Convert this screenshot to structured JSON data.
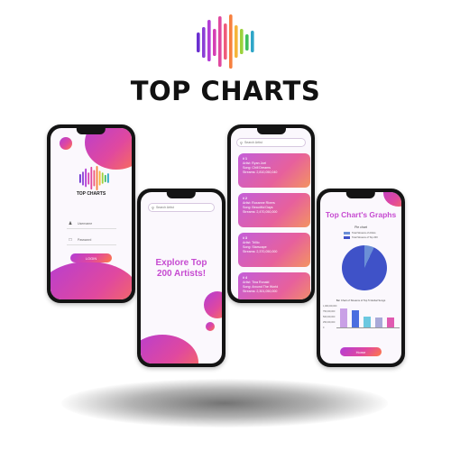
{
  "brand": {
    "title": "TOP CHARTS",
    "bar_colors": [
      "#6a2fd0",
      "#8b3fd6",
      "#b23dd6",
      "#d63fb4",
      "#e0489f",
      "#ef5b7a",
      "#f7803e",
      "#f5b53a",
      "#9bd23c",
      "#3fbf5c",
      "#2fa6c8"
    ]
  },
  "login": {
    "logo_title": "TOP CHARTS",
    "username_placeholder": "Username",
    "password_placeholder": "Password",
    "login_button": "LOGIN"
  },
  "explore": {
    "search_placeholder": "Search Artist",
    "headline_line1": "Explore Top",
    "headline_line2": "200 Artists!"
  },
  "list": {
    "search_placeholder": "Search Artist",
    "cards": [
      {
        "rank": "# 1",
        "artist": "Artist: Ryan Joel",
        "song": "Song: Chill Dreams",
        "streams": "Streams: 2,810,050,040"
      },
      {
        "rank": "# 2",
        "artist": "Artist: Roxanne Rivers",
        "song": "Song: Beautiful Days",
        "streams": "Streams: 2,470,050,000"
      },
      {
        "rank": "# 3",
        "artist": "Artist: Trillio",
        "song": "Song: Starscape",
        "streams": "Streams: 2,370,050,000"
      },
      {
        "rank": "# 4",
        "artist": "Artist: Tina Ronald",
        "song": "Song: Around The World",
        "streams": "Streams: 2,301,050,000"
      }
    ]
  },
  "graphs": {
    "title": "Top Chart's Graphs",
    "pie_caption": "Pie chart",
    "pie_legend": [
      "Total Streams of Artists",
      "Total Streams of Top 200"
    ],
    "bar_caption": "Bar Chart of Streams of Top 5 Global Songs",
    "yticks": [
      "1,000,000,000",
      "750,000,000",
      "500,000,000",
      "250,000,000",
      "0"
    ],
    "button": "Home"
  },
  "chart_data": [
    {
      "type": "pie",
      "title": "Pie chart",
      "labels": [
        "Total Streams of Artists",
        "Total Streams of Top 200"
      ],
      "values": [
        7,
        93
      ],
      "colors": [
        "#6b8fd6",
        "#3f52c8"
      ]
    },
    {
      "type": "bar",
      "title": "Bar Chart of Streams of Top 5 Global Songs",
      "categories": [
        "Song 1",
        "Song 2",
        "Song 3",
        "Song 4",
        "Song 5"
      ],
      "values": [
        800000000,
        720000000,
        460000000,
        420000000,
        410000000
      ],
      "colors": [
        "#c9a0e6",
        "#4a6ee0",
        "#6cc8e0",
        "#a9a9d8",
        "#e05ab0"
      ],
      "ylim": [
        0,
        1000000000
      ]
    }
  ]
}
